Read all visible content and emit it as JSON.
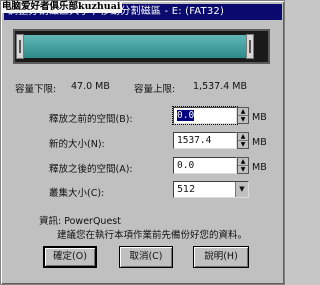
{
  "window": {
    "watermark": "电脑爱好者俱乐部kuzhuai",
    "title": "調整分割磁區大小 / 移動分割磁區 - E:  (FAT32)"
  },
  "partition_bar": {
    "fill_fraction": 0.93
  },
  "limits": {
    "min_label": "容量下限:",
    "min_value": "47.0 MB",
    "max_label": "容量上限:",
    "max_value": "1,537.4 MB"
  },
  "fields": {
    "free_before": {
      "label": "釋放之前的空間(B):",
      "value": "0.0",
      "unit": "MB"
    },
    "new_size": {
      "label": "新的大小(N):",
      "value": "1537.4",
      "unit": "MB"
    },
    "free_after": {
      "label": "釋放之後的空間(A):",
      "value": "0.0",
      "unit": "MB"
    },
    "cluster_size": {
      "label": "叢集大小(C):",
      "value": "512"
    }
  },
  "info": {
    "line1": "資訊: PowerQuest",
    "line2": "建議您在執行本項作業前先備份好您的資料。"
  },
  "buttons": {
    "ok": "確定(O)",
    "cancel": "取消(C)",
    "help": "說明(H)"
  },
  "colors": {
    "titlebar": "#0a0a6e",
    "bar_fill": "#2f8a8a",
    "selection": "#000080"
  }
}
